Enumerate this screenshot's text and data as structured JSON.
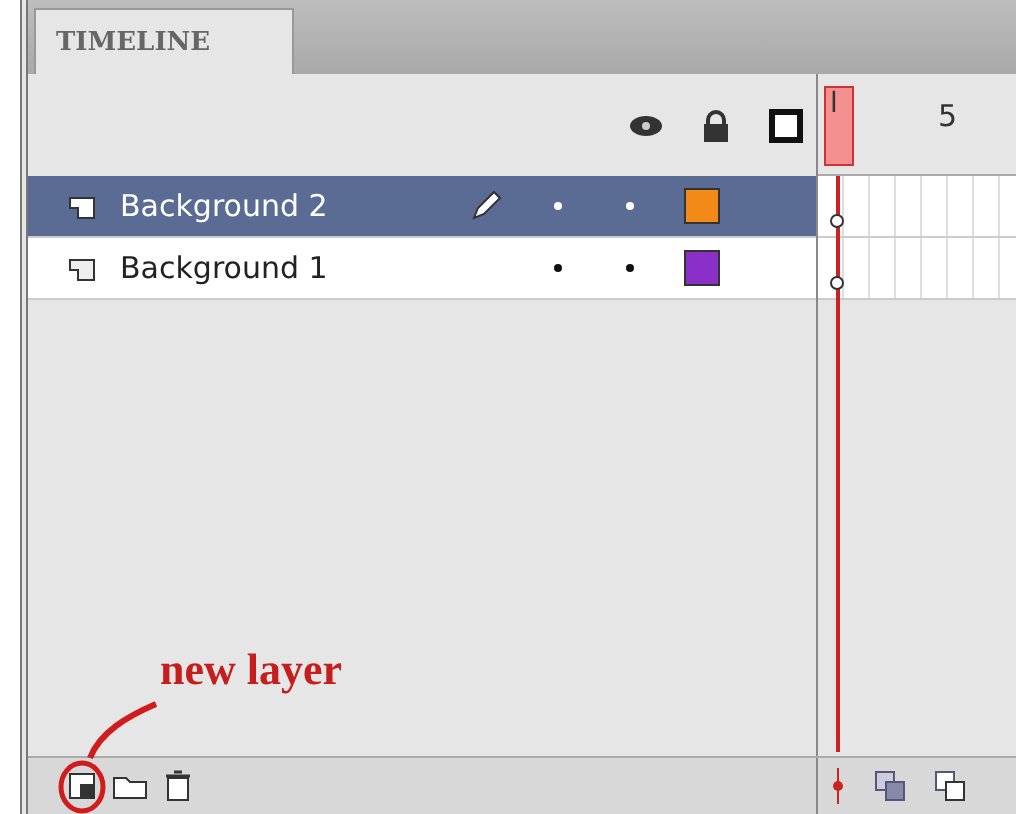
{
  "panel": {
    "tab": "TIMELINE"
  },
  "frame_header": {
    "playhead_label": "l",
    "frame_label": "5"
  },
  "layers": [
    {
      "name": "Background 2",
      "selected": true,
      "editing": true,
      "color": "#f28a1a"
    },
    {
      "name": "Background 1",
      "selected": false,
      "editing": false,
      "color": "#8a2fc8"
    }
  ],
  "annotation": {
    "text": "new layer"
  }
}
